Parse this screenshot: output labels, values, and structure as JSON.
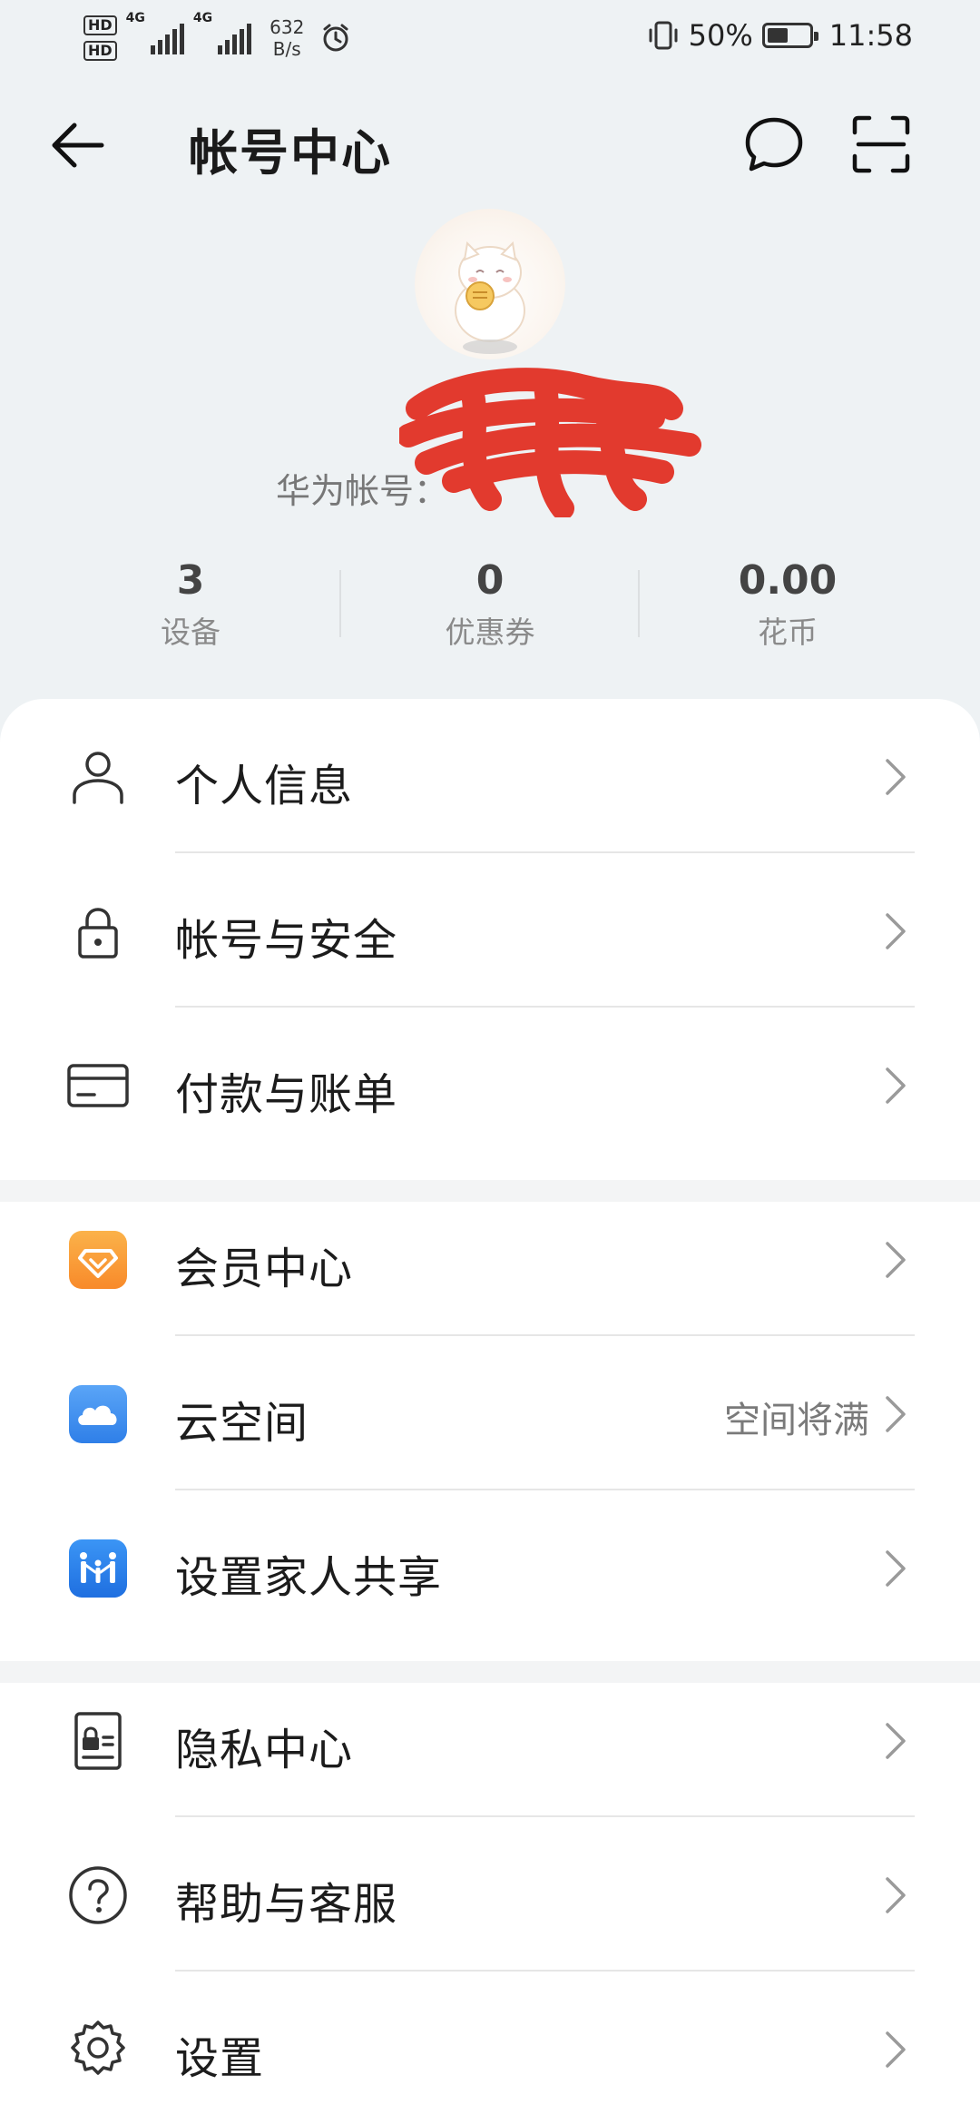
{
  "status_bar": {
    "hd1": "HD",
    "hd2": "HD",
    "net1": "4G",
    "net2": "4G",
    "speed_value": "632",
    "speed_unit": "B/s",
    "battery": "50%",
    "battery_level": 0.5,
    "time": "11:58"
  },
  "header": {
    "title": "帐号中心"
  },
  "profile": {
    "name": "",
    "account_label": "华为帐号："
  },
  "stats": [
    {
      "value": "3",
      "label": "设备"
    },
    {
      "value": "0",
      "label": "优惠券"
    },
    {
      "value": "0.00",
      "label": "花币"
    }
  ],
  "menu": {
    "personal_info": "个人信息",
    "account_security": "帐号与安全",
    "payment_billing": "付款与账单",
    "member_center": "会员中心",
    "cloud_space": "云空间",
    "cloud_space_status": "空间将满",
    "family_sharing": "设置家人共享",
    "privacy_center": "隐私中心",
    "help_service": "帮助与客服",
    "settings": "设置"
  },
  "colors": {
    "background": "#eef2f4",
    "member_orange": "#f9a43a",
    "cloud_blue": "#3f8ff1",
    "family_blue": "#2f7ff0",
    "redaction_red": "#e23a2e"
  }
}
